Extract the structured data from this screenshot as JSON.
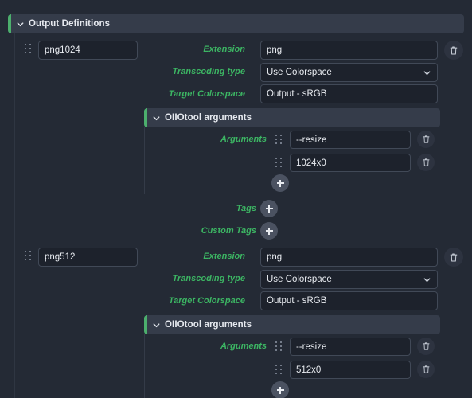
{
  "panel": {
    "header": {
      "title": "Output Definitions",
      "collapse_icon": "chevron-down-icon",
      "accent_color": "#4caf6d"
    }
  },
  "labels": {
    "extension": "Extension",
    "transcoding_type": "Transcoding type",
    "target_colorspace": "Target Colorspace",
    "arguments": "Arguments",
    "tags": "Tags",
    "custom_tags": "Custom Tags"
  },
  "icons": {
    "drag_handle": "drag-handle-icon",
    "delete": "trash-icon",
    "add": "plus-icon",
    "dropdown": "chevron-down-icon"
  },
  "outputs": [
    {
      "name": "png1024",
      "extension": "png",
      "transcoding_type": "Use Colorspace",
      "target_colorspace": "Output - sRGB",
      "oiio": {
        "title": "OIIOtool arguments",
        "arguments": [
          "--resize",
          "1024x0"
        ]
      },
      "tags": [],
      "custom_tags": []
    },
    {
      "name": "png512",
      "extension": "png",
      "transcoding_type": "Use Colorspace",
      "target_colorspace": "Output - sRGB",
      "oiio": {
        "title": "OIIOtool arguments",
        "arguments": [
          "--resize",
          "512x0"
        ]
      },
      "tags": [],
      "custom_tags": []
    }
  ],
  "colors": {
    "background": "#242a35",
    "header_bar": "#353c4a",
    "accent_green": "#4caf6d",
    "label_green": "#3cb563",
    "input_bg": "#1d222c",
    "input_border": "#414957",
    "text": "#e9ecf1"
  }
}
